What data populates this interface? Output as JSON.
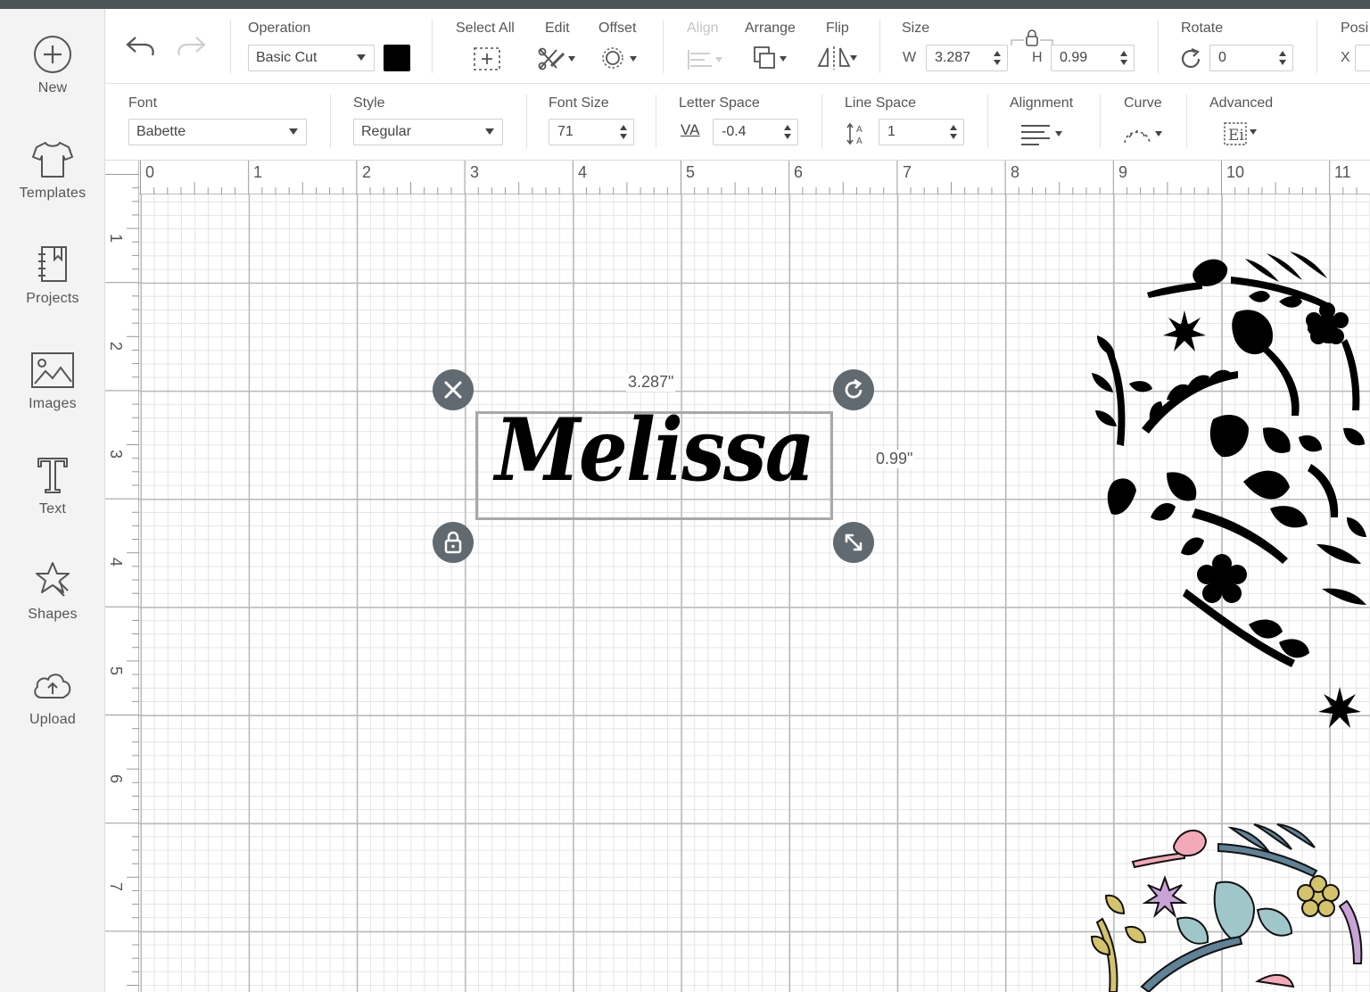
{
  "sidebar": {
    "items": [
      {
        "label": "New",
        "icon": "plus-circle-icon"
      },
      {
        "label": "Templates",
        "icon": "tshirt-icon"
      },
      {
        "label": "Projects",
        "icon": "notebook-icon"
      },
      {
        "label": "Images",
        "icon": "image-icon"
      },
      {
        "label": "Text",
        "icon": "text-t-icon"
      },
      {
        "label": "Shapes",
        "icon": "shapes-icon"
      },
      {
        "label": "Upload",
        "icon": "cloud-upload-icon"
      }
    ]
  },
  "toolbar": {
    "operation": {
      "label": "Operation",
      "value": "Basic Cut",
      "color": "#000000"
    },
    "select_all": "Select All",
    "edit": "Edit",
    "offset": "Offset",
    "align": "Align",
    "arrange": "Arrange",
    "flip": "Flip",
    "size": {
      "label": "Size",
      "w_label": "W",
      "w": "3.287",
      "h_label": "H",
      "h": "0.99"
    },
    "rotate": {
      "label": "Rotate",
      "value": "0"
    },
    "position": {
      "label": "Posi",
      "x_label": "X"
    }
  },
  "text_toolbar": {
    "font": {
      "label": "Font",
      "value": "Babette"
    },
    "style": {
      "label": "Style",
      "value": "Regular"
    },
    "font_size": {
      "label": "Font Size",
      "value": "71"
    },
    "letter_space": {
      "label": "Letter Space",
      "value": "-0.4",
      "icon_text": "VA"
    },
    "line_space": {
      "label": "Line Space",
      "value": "1"
    },
    "alignment": "Alignment",
    "curve": "Curve",
    "advanced": "Advanced"
  },
  "ruler": {
    "horizontal": [
      "0",
      "1",
      "2",
      "3",
      "4",
      "5",
      "6",
      "7",
      "8",
      "9",
      "10",
      "11"
    ],
    "vertical": [
      "1",
      "2",
      "3",
      "4",
      "5",
      "6",
      "7"
    ]
  },
  "selection": {
    "text": "Melissa",
    "width_label": "3.287\"",
    "height_label": "0.99\""
  },
  "colors": {
    "accent": "#616a70",
    "pastel": [
      "#f4a9b8",
      "#d4c36a",
      "#9fc7c9",
      "#5f8296",
      "#c9a3d6"
    ]
  }
}
